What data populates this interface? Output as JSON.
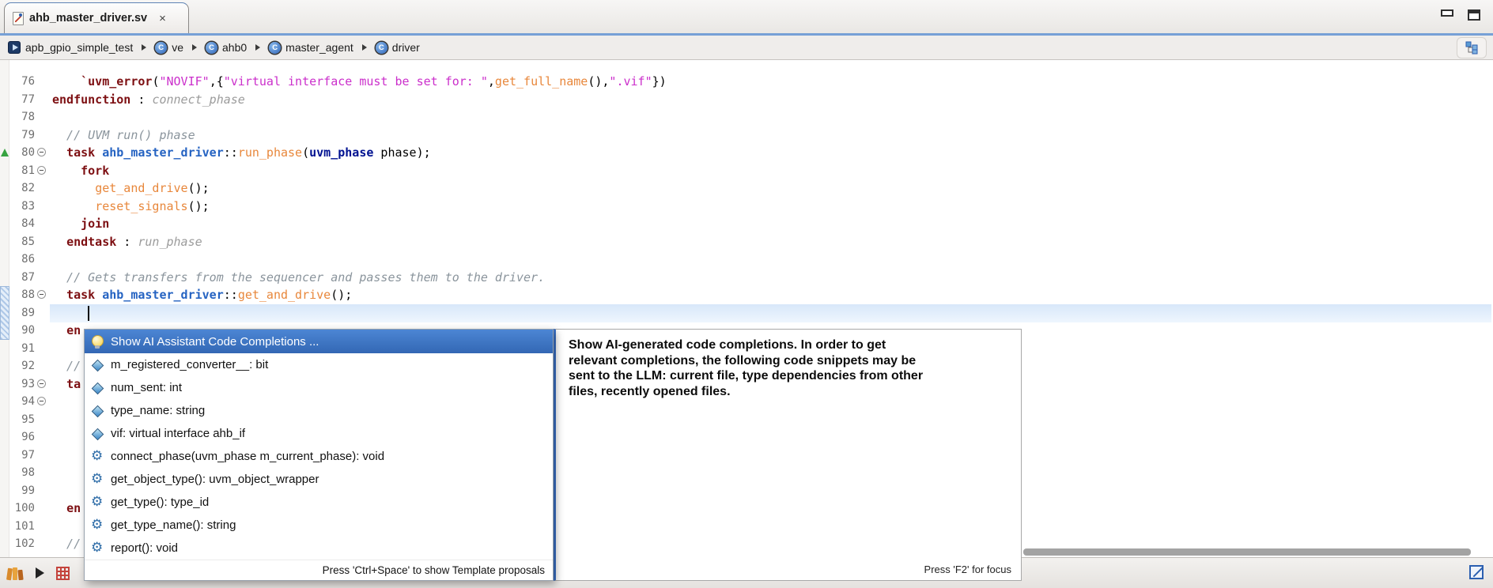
{
  "window": {
    "tab_title": "ahb_master_driver.sv",
    "tab_close": "×"
  },
  "breadcrumb": {
    "items": [
      "apb_gpio_simple_test",
      "ve",
      "ahb0",
      "master_agent",
      "driver"
    ],
    "class_icon_letter": "C"
  },
  "editor": {
    "cursor_line": 89,
    "lines": [
      {
        "num": 76,
        "fold": false,
        "segments": [
          {
            "c": "p",
            "t": "    "
          },
          {
            "c": "k",
            "t": "`uvm_error"
          },
          {
            "c": "p",
            "t": "("
          },
          {
            "c": "s",
            "t": "\"NOVIF\""
          },
          {
            "c": "p",
            "t": ",{"
          },
          {
            "c": "s",
            "t": "\"virtual interface must be set for: \""
          },
          {
            "c": "p",
            "t": ","
          },
          {
            "c": "f",
            "t": "get_full_name"
          },
          {
            "c": "p",
            "t": "(),"
          },
          {
            "c": "s",
            "t": "\".vif\""
          },
          {
            "c": "p",
            "t": "})"
          }
        ]
      },
      {
        "num": 77,
        "fold": false,
        "segments": [
          {
            "c": "k",
            "t": "endfunction"
          },
          {
            "c": "p",
            "t": " : "
          },
          {
            "c": "l",
            "t": "connect_phase"
          }
        ]
      },
      {
        "num": 78,
        "fold": false,
        "segments": []
      },
      {
        "num": 79,
        "fold": false,
        "segments": [
          {
            "c": "c",
            "t": "  // UVM run() phase"
          }
        ]
      },
      {
        "num": 80,
        "fold": true,
        "segments": [
          {
            "c": "p",
            "t": "  "
          },
          {
            "c": "k",
            "t": "task"
          },
          {
            "c": "p",
            "t": " "
          },
          {
            "c": "t",
            "t": "ahb_master_driver"
          },
          {
            "c": "p",
            "t": "::"
          },
          {
            "c": "f",
            "t": "run_phase"
          },
          {
            "c": "p",
            "t": "("
          },
          {
            "c": "n",
            "t": "uvm_phase"
          },
          {
            "c": "p",
            "t": " phase);"
          }
        ]
      },
      {
        "num": 81,
        "fold": true,
        "segments": [
          {
            "c": "p",
            "t": "    "
          },
          {
            "c": "k",
            "t": "fork"
          }
        ]
      },
      {
        "num": 82,
        "fold": false,
        "segments": [
          {
            "c": "p",
            "t": "      "
          },
          {
            "c": "f",
            "t": "get_and_drive"
          },
          {
            "c": "p",
            "t": "();"
          }
        ]
      },
      {
        "num": 83,
        "fold": false,
        "segments": [
          {
            "c": "p",
            "t": "      "
          },
          {
            "c": "f",
            "t": "reset_signals"
          },
          {
            "c": "p",
            "t": "();"
          }
        ]
      },
      {
        "num": 84,
        "fold": false,
        "segments": [
          {
            "c": "p",
            "t": "    "
          },
          {
            "c": "k",
            "t": "join"
          }
        ]
      },
      {
        "num": 85,
        "fold": false,
        "segments": [
          {
            "c": "p",
            "t": "  "
          },
          {
            "c": "k",
            "t": "endtask"
          },
          {
            "c": "p",
            "t": " : "
          },
          {
            "c": "l",
            "t": "run_phase"
          }
        ]
      },
      {
        "num": 86,
        "fold": false,
        "segments": []
      },
      {
        "num": 87,
        "fold": false,
        "segments": [
          {
            "c": "c",
            "t": "  // Gets transfers from the sequencer and passes them to the driver."
          }
        ]
      },
      {
        "num": 88,
        "fold": true,
        "segments": [
          {
            "c": "p",
            "t": "  "
          },
          {
            "c": "k",
            "t": "task"
          },
          {
            "c": "p",
            "t": " "
          },
          {
            "c": "t",
            "t": "ahb_master_driver"
          },
          {
            "c": "p",
            "t": "::"
          },
          {
            "c": "f",
            "t": "get_and_drive"
          },
          {
            "c": "p",
            "t": "();"
          }
        ]
      },
      {
        "num": 89,
        "fold": false,
        "segments": []
      },
      {
        "num": 90,
        "fold": false,
        "segments": [
          {
            "c": "p",
            "t": "  "
          },
          {
            "c": "k",
            "t": "en"
          }
        ]
      },
      {
        "num": 91,
        "fold": false,
        "segments": []
      },
      {
        "num": 92,
        "fold": false,
        "segments": [
          {
            "c": "c",
            "t": "  //"
          }
        ]
      },
      {
        "num": 93,
        "fold": true,
        "segments": [
          {
            "c": "p",
            "t": "  "
          },
          {
            "c": "k",
            "t": "ta"
          }
        ]
      },
      {
        "num": 94,
        "fold": true,
        "segments": []
      },
      {
        "num": 95,
        "fold": false,
        "segments": []
      },
      {
        "num": 96,
        "fold": false,
        "segments": []
      },
      {
        "num": 97,
        "fold": false,
        "segments": []
      },
      {
        "num": 98,
        "fold": false,
        "segments": []
      },
      {
        "num": 99,
        "fold": false,
        "segments": []
      },
      {
        "num": 100,
        "fold": false,
        "segments": [
          {
            "c": "p",
            "t": "  "
          },
          {
            "c": "k",
            "t": "en"
          }
        ]
      },
      {
        "num": 101,
        "fold": false,
        "segments": []
      },
      {
        "num": 102,
        "fold": false,
        "segments": [
          {
            "c": "c",
            "t": "  //"
          }
        ]
      }
    ]
  },
  "completion": {
    "selected": {
      "icon": "lightbulb-icon",
      "label": "Show AI Assistant Code Completions ..."
    },
    "items": [
      {
        "icon": "field-icon",
        "label": "m_registered_converter__: bit"
      },
      {
        "icon": "field-icon",
        "label": "num_sent: int"
      },
      {
        "icon": "field-icon",
        "label": "type_name: string"
      },
      {
        "icon": "field-icon",
        "label": "vif: virtual interface ahb_if"
      },
      {
        "icon": "method-icon",
        "label": "connect_phase(uvm_phase m_current_phase): void"
      },
      {
        "icon": "method-icon",
        "label": "get_object_type(): uvm_object_wrapper"
      },
      {
        "icon": "method-icon",
        "label": "get_type(): type_id"
      },
      {
        "icon": "method-icon",
        "label": "get_type_name(): string"
      },
      {
        "icon": "method-icon",
        "label": "report(): void"
      }
    ],
    "footer": "Press 'Ctrl+Space' to show Template proposals"
  },
  "doc_popup": {
    "text_lines": [
      "Show AI-generated code completions. In order to get",
      "relevant completions, the following code snippets may be",
      "sent to the LLM: current file, type dependencies from other",
      "files, recently opened files."
    ],
    "footer": "Press 'F2' for focus"
  },
  "colors": {
    "selection_blue": "#3d76c4",
    "breadcrumb_accent": "#2a62b8",
    "keyword": "#7d0f12",
    "string": "#cb2fcb",
    "function": "#e8873b",
    "class_type": "#2563c2",
    "tab_underline": "#76a0d6"
  },
  "icons": [
    "sv-file-icon",
    "close-icon",
    "minimize-icon",
    "maximize-icon",
    "module-icon",
    "class-icon",
    "breadcrumb-arrow-icon",
    "hierarchy-icon",
    "green-arrow-marker-icon",
    "fold-collapse-icon",
    "lightbulb-icon",
    "field-icon",
    "method-icon",
    "library-icon",
    "run-icon",
    "grid-icon",
    "fast-view-icon"
  ]
}
